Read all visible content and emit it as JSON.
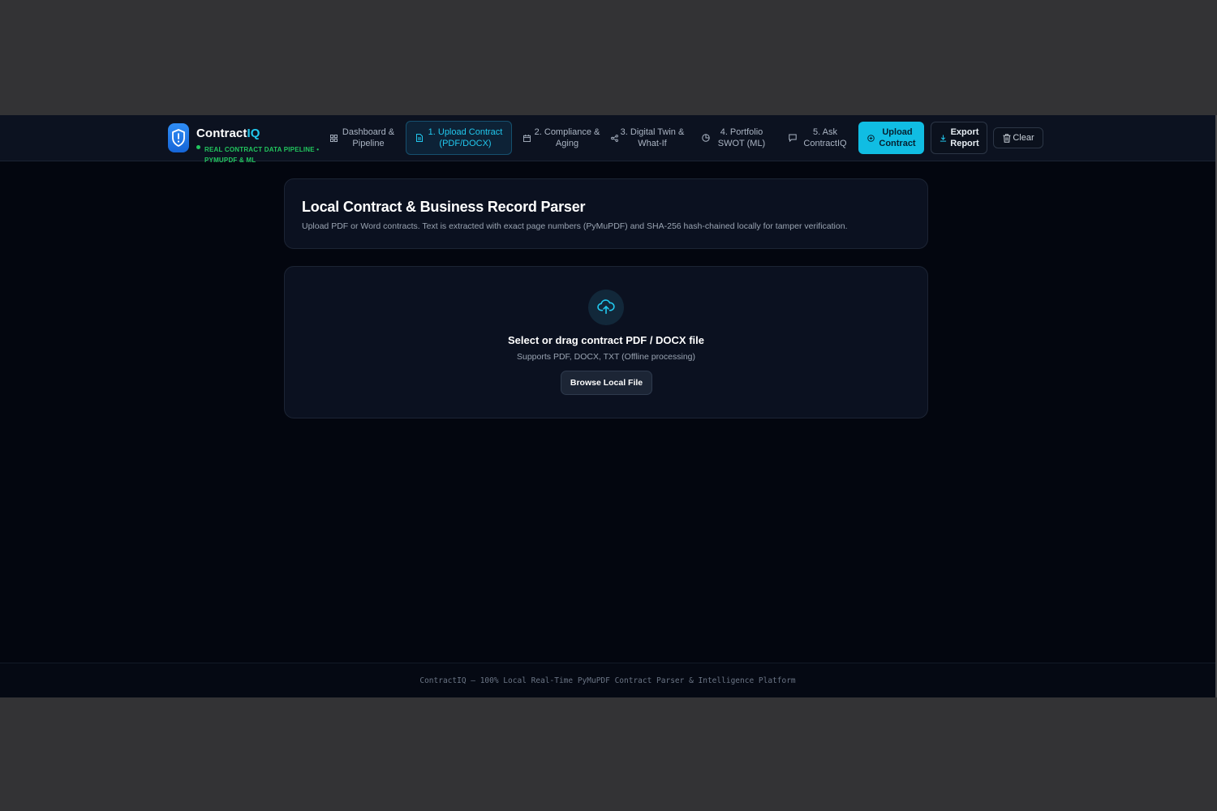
{
  "brand": {
    "name_main": "Contract",
    "name_accent": "IQ",
    "subtitle": "REAL CONTRACT DATA PIPELINE • PYMUPDF & ML",
    "logo_icon": "shield-alert-icon",
    "status_color": "#22c55e",
    "accent_color": "#22c8ee"
  },
  "nav": {
    "items": [
      {
        "label": "Dashboard & Pipeline",
        "icon": "grid-icon"
      },
      {
        "label": "1. Upload Contract (PDF/DOCX)",
        "icon": "file-icon",
        "active": true
      },
      {
        "label": "2. Compliance & Aging",
        "icon": "calendar-icon"
      },
      {
        "label": "3. Digital Twin & What-If",
        "icon": "share-icon"
      },
      {
        "label": "4. Portfolio SWOT (ML)",
        "icon": "pie-chart-icon"
      },
      {
        "label": "5. Ask ContractIQ",
        "icon": "chat-icon"
      }
    ]
  },
  "actions": {
    "upload": "Upload Contract",
    "export": "Export Report",
    "clear": "Clear"
  },
  "intro": {
    "title": "Local Contract & Business Record Parser",
    "description": "Upload PDF or Word contracts. Text is extracted with exact page numbers (PyMuPDF) and SHA-256 hash-chained locally for tamper verification."
  },
  "upload": {
    "icon": "cloud-upload-icon",
    "title": "Select or drag contract PDF / DOCX file",
    "subtitle": "Supports PDF, DOCX, TXT (Offline processing)",
    "button": "Browse Local File"
  },
  "footer": {
    "text": "ContractIQ — 100% Local Real-Time PyMuPDF Contract Parser & Intelligence Platform"
  }
}
